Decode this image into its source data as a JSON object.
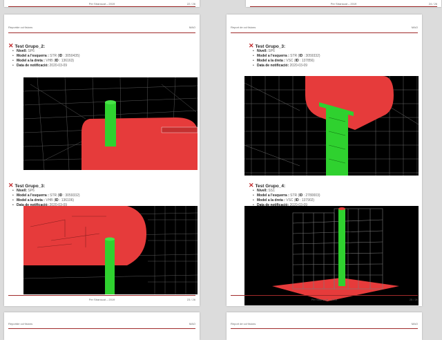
{
  "pages": {
    "top_left": {
      "footer_center": "Per Stranscat – 2019",
      "footer_right": "22 / 26"
    },
    "top_right": {
      "footer_center": "Per Stranscat – 2019",
      "footer_right": "24 / 26"
    },
    "left": {
      "header_left": "Reportde col·lisions",
      "header_right": "MAO",
      "footer_center": "Per Stranscat – 2019",
      "footer_right": "23 / 26",
      "tests": [
        {
          "title": "Test Grupo_2:",
          "nivel_label": "Nivell:",
          "nivel": "SP6",
          "left_label": "Model a l'esquerra :",
          "left_value": "STR (",
          "left_id_label": "ID",
          "left_id": ": 3050435)",
          "right_label": "Model a la dreta :",
          "right_value": "VHB (",
          "right_id_label": "ID",
          "right_id": ": 136163)",
          "date_label": "Data de notificació:",
          "date": "2020-03-09"
        },
        {
          "title": "Test Grupo_3:",
          "nivel_label": "Nivell:",
          "nivel": "SP6",
          "left_label": "Model a l'esquerra :",
          "left_value": "STR (",
          "left_id_label": "ID",
          "left_id": ": 3059332)",
          "right_label": "Model a la dreta :",
          "right_value": "VHB (",
          "right_id_label": "ID",
          "right_id": ": 136106)",
          "date_label": "Data de notificació:",
          "date": "2020-03-09"
        }
      ]
    },
    "right": {
      "header_left": "Report de col·lisions",
      "header_right": "MAO",
      "footer_center": "Per Stranscat – 2019",
      "footer_right": "25 / 26",
      "tests": [
        {
          "title": "Test Grupo_3:",
          "nivel_label": "Nivell:",
          "nivel": "SP6",
          "left_label": "Model a l'esquerra :",
          "left_value": "STR (",
          "left_id_label": "ID",
          "left_id": ": 3059332)",
          "right_label": "Model a la dreta :",
          "right_value": "VSC (",
          "right_id_label": "ID",
          "right_id": ": 137856)",
          "date_label": "Data de notificació:",
          "date": "2020-03-09"
        },
        {
          "title": "Test Grupo_4:",
          "nivel_label": "Nivell:",
          "nivel": "SS1",
          "left_label": "Model a l'esquerra :",
          "left_value": "STR (",
          "left_id_label": "ID",
          "left_id": ": 2780003)",
          "right_label": "Model a la dreta :",
          "right_value": "VSC (",
          "right_id_label": "ID",
          "right_id": ": 137902)",
          "date_label": "Data de notificació:",
          "date": "2020-03-09"
        }
      ]
    },
    "bottom_left": {
      "header_left": "Reportde col·lisions",
      "header_right": "MAO"
    },
    "bottom_right": {
      "header_left": "Report de col·lisions",
      "header_right": "MAO"
    }
  },
  "icons": {
    "clash": "x-mark-icon"
  },
  "colors": {
    "clash_red": "#c0282a",
    "structure_red": "#e63b3b",
    "duct_green": "#2fd12f",
    "rule": "#a02a2a"
  }
}
